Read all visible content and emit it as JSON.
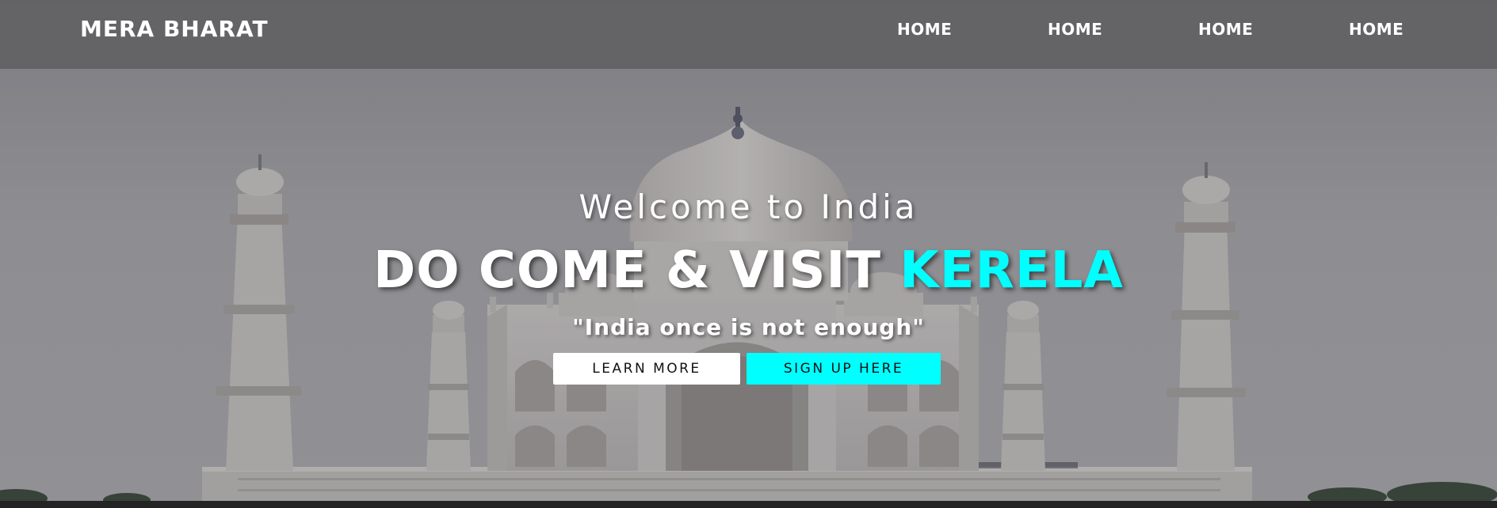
{
  "brand": "MERA BHARAT",
  "nav": {
    "items": [
      {
        "label": "HOME"
      },
      {
        "label": "HOME"
      },
      {
        "label": "HOME"
      },
      {
        "label": "HOME"
      }
    ]
  },
  "hero": {
    "welcome": "Welcome to India",
    "headline_main": "DO COME & VISIT ",
    "headline_accent": "KERELA",
    "tagline": "\"India once is not enough\"",
    "learn_more_label": "LEARN MORE",
    "signup_label": "SIGN UP HERE",
    "background_image": "taj-mahal-photo"
  },
  "colors": {
    "accent": "#00ffff",
    "navbar": "#5f5f62",
    "text": "#ffffff"
  }
}
